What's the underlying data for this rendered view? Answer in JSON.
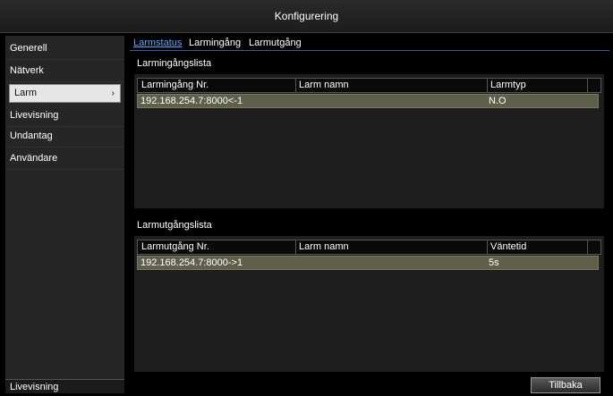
{
  "window": {
    "title": "Konfigurering"
  },
  "sidebar": {
    "items": [
      {
        "label": "Generell"
      },
      {
        "label": "Nätverk"
      },
      {
        "label": "Larm",
        "selected": true
      },
      {
        "label": "Livevisning"
      },
      {
        "label": "Undantag"
      },
      {
        "label": "Användare"
      }
    ],
    "bottom_label": "Livevisning"
  },
  "tabs": [
    {
      "label": "Larmstatus",
      "active": true
    },
    {
      "label": "Larmingång"
    },
    {
      "label": "Larmutgång"
    }
  ],
  "inputs": {
    "title": "Larmingångslista",
    "columns": [
      "Larmingång Nr.",
      "Larm namn",
      "Larmtyp"
    ],
    "rows": [
      {
        "nr": "192.168.254.7:8000<-1",
        "name": "",
        "type": "N.O"
      }
    ]
  },
  "outputs": {
    "title": "Larmutgångslista",
    "columns": [
      "Larmutgång Nr.",
      "Larm namn",
      "Väntetid"
    ],
    "rows": [
      {
        "nr": "192.168.254.7:8000->1",
        "name": "",
        "wait": "5s"
      }
    ]
  },
  "buttons": {
    "back_label": "Tillbaka"
  },
  "colors": {
    "active_tab": "#5aa8ff",
    "row_highlight": "#5f5f4a",
    "selected_item": "#e6e6e6"
  }
}
